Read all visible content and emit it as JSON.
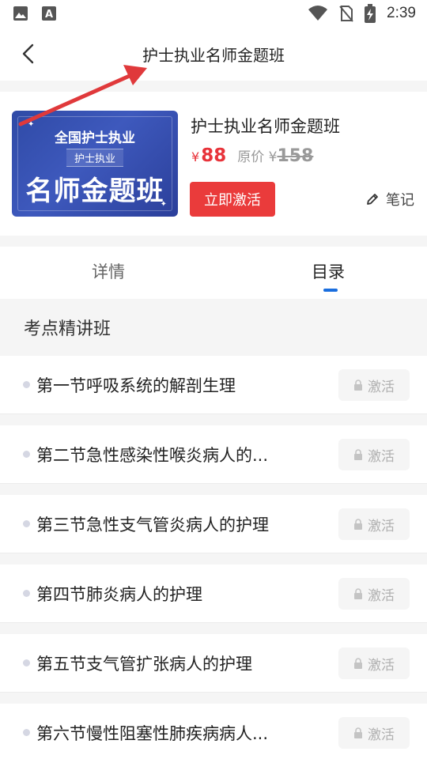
{
  "status_bar": {
    "time": "2:39",
    "left_icons": [
      "image-icon",
      "text-a-icon"
    ],
    "right_icons": [
      "wifi-icon",
      "no-sim-icon",
      "battery-charging-icon"
    ]
  },
  "header": {
    "title": "护士执业名师金题班",
    "back_icon": "chevron-left-icon"
  },
  "course": {
    "cover": {
      "line1": "全国护士执业",
      "line2": "护士执业",
      "line3": "名师金题班"
    },
    "title": "护士执业名师金题班",
    "price_symbol": "¥",
    "price": "88",
    "original_label": "原价 ¥",
    "original_price": "158",
    "activate_label": "立即激活",
    "notes_label": "笔记"
  },
  "tabs": [
    {
      "label": "详情",
      "active": false
    },
    {
      "label": "目录",
      "active": true
    }
  ],
  "section": {
    "title": "考点精讲班"
  },
  "lessons": [
    {
      "title": "第一节呼吸系统的解剖生理",
      "button": "激活"
    },
    {
      "title": "第二节急性感染性喉炎病人的...",
      "button": "激活"
    },
    {
      "title": "第三节急性支气管炎病人的护理",
      "button": "激活"
    },
    {
      "title": "第四节肺炎病人的护理",
      "button": "激活"
    },
    {
      "title": "第五节支气管扩张病人的护理",
      "button": "激活"
    },
    {
      "title": "第六节慢性阻塞性肺疾病病人...",
      "button": "激活"
    }
  ],
  "colors": {
    "accent_red": "#ea3b3b",
    "price_red": "#e8333a",
    "tab_blue": "#1a6ede",
    "annotation_red": "#e0393b"
  }
}
